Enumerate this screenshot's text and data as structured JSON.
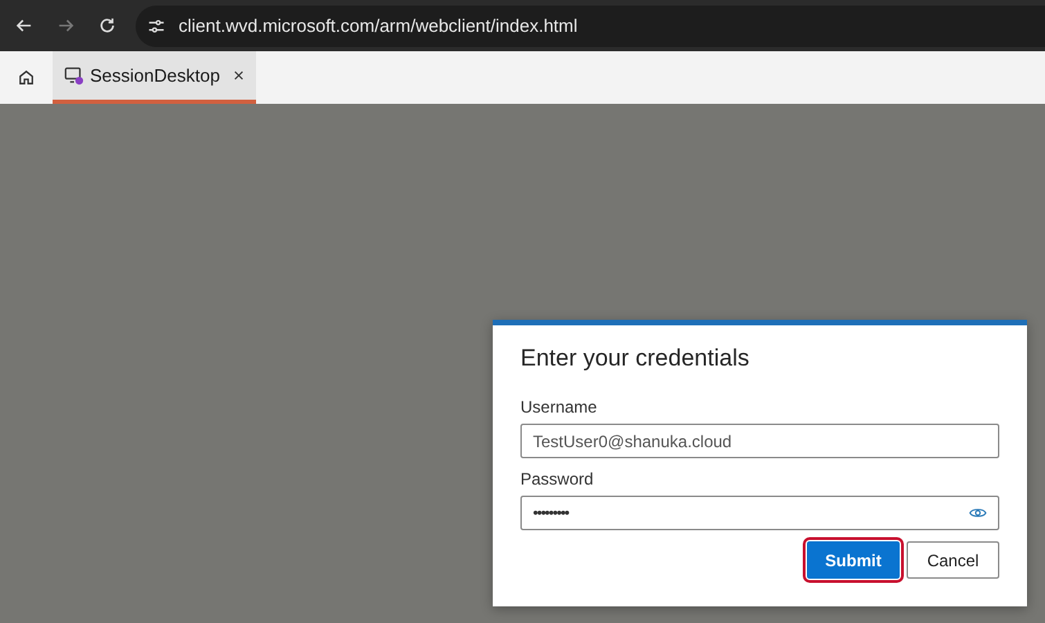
{
  "browser": {
    "url": "client.wvd.microsoft.com/arm/webclient/index.html",
    "forward_disabled": true
  },
  "tabs": [
    {
      "label": "SessionDesktop",
      "selected": true
    }
  ],
  "dialog": {
    "title": "Enter your credentials",
    "fields": [
      {
        "kind": "text",
        "label": "Username",
        "value": "TestUser0@shanuka.cloud"
      },
      {
        "kind": "password",
        "label": "Password",
        "value": "•••••••••"
      }
    ],
    "buttons": [
      {
        "label": "Submit",
        "kind": "primary",
        "highlighted": true
      },
      {
        "label": "Cancel",
        "kind": "secondary",
        "highlighted": false
      }
    ]
  }
}
